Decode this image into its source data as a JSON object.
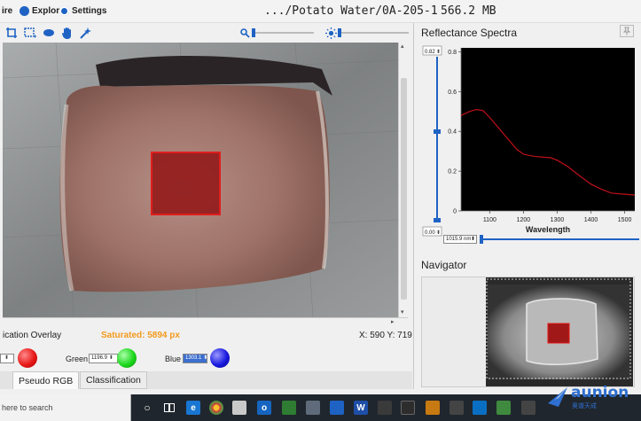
{
  "menu": {
    "acquire_label": "ire",
    "explore_label": "Explore",
    "settings_label": "Settings"
  },
  "title": {
    "path": ".../Potato Water/0A-205-1",
    "size": "566.2 MB"
  },
  "viewer": {
    "overlay_label": "ication Overlay",
    "saturated_text": "Saturated: 5894 px",
    "coords_text": "X: 590 Y: 719"
  },
  "color_channels": {
    "red": {
      "value": "",
      "color": "#e81818"
    },
    "green": {
      "label": "Green",
      "value": "1196.9",
      "color": "#1ed81e"
    },
    "blue": {
      "label": "Blue",
      "value": "1303.1",
      "color": "#1a1ae0"
    }
  },
  "tabs": [
    {
      "label": "Pseudo RGB",
      "active": true
    },
    {
      "label": "Classification",
      "active": false
    }
  ],
  "spectra": {
    "title": "Reflectance Spectra",
    "ymax_field": "0.82",
    "ymin_field": "0.00",
    "wavelength_field": "1015.9 nm",
    "navigator_title": "Navigator"
  },
  "chart_data": {
    "type": "line",
    "title": "",
    "xlabel": "Wavelength",
    "ylabel": "",
    "xlim": [
      1015,
      1530
    ],
    "ylim": [
      0,
      0.82
    ],
    "x_ticks": [
      1100,
      1200,
      1300,
      1400,
      1500
    ],
    "y_ticks": [
      0,
      0.2,
      0.4,
      0.6,
      0.8
    ],
    "grid": false,
    "series": [
      {
        "color": "#c0101a",
        "x": [
          1015,
          1040,
          1060,
          1080,
          1100,
          1120,
          1150,
          1180,
          1200,
          1230,
          1260,
          1280,
          1300,
          1330,
          1360,
          1380,
          1400,
          1430,
          1460,
          1490,
          1530
        ],
        "y": [
          0.48,
          0.5,
          0.51,
          0.505,
          0.47,
          0.43,
          0.37,
          0.31,
          0.285,
          0.275,
          0.27,
          0.268,
          0.255,
          0.225,
          0.185,
          0.16,
          0.135,
          0.11,
          0.09,
          0.085,
          0.08
        ]
      }
    ]
  },
  "taskbar": {
    "search_text": "here to search",
    "watermark_text": "aunion",
    "watermark_sub": "奥谱天成"
  },
  "icons": {
    "pin": "pin-icon",
    "crop": "crop-icon",
    "select": "rect-select-icon",
    "pan": "hand-icon",
    "magic": "wand-icon",
    "zoom": "zoom-icon",
    "brightness": "brightness-icon"
  }
}
